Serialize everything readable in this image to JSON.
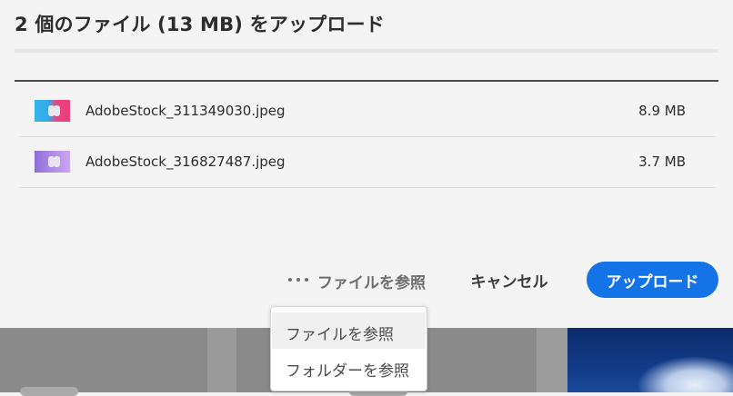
{
  "dialog": {
    "title": "2 個のファイル (13 MB) をアップロード"
  },
  "files": [
    {
      "name": "AdobeStock_311349030.jpeg",
      "size": "8.9 MB"
    },
    {
      "name": "AdobeStock_316827487.jpeg",
      "size": "3.7 MB"
    }
  ],
  "actions": {
    "browse_label": "ファイルを参照",
    "cancel_label": "キャンセル",
    "upload_label": "アップロード"
  },
  "menu": {
    "items": [
      {
        "label": "ファイルを参照"
      },
      {
        "label": "フォルダーを参照"
      }
    ]
  },
  "colors": {
    "accent": "#1473e6",
    "dialog_bg": "#f4f4f4"
  }
}
